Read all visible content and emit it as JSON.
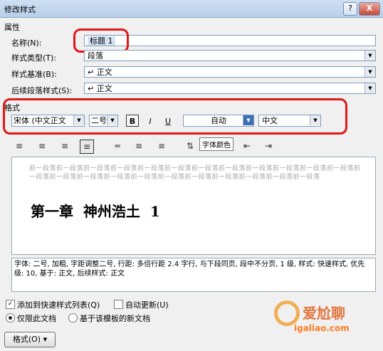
{
  "window": {
    "title": "修改样式",
    "help": "?",
    "close": "X"
  },
  "properties": {
    "section": "属性",
    "name_label": "名称(N):",
    "name_value": "标题 1",
    "type_label": "样式类型(T):",
    "type_value": "段落",
    "based_label": "样式基准(B):",
    "based_value": "↵ 正文",
    "next_label": "后续段落样式(S):",
    "next_value": "↵ 正文"
  },
  "format": {
    "section": "格式",
    "font": "宋体 (中文正文",
    "size": "二号",
    "bold": "B",
    "italic": "I",
    "underline": "U",
    "color": "自动",
    "lang": "中文",
    "tooltip": "字体颜色"
  },
  "preview": {
    "prev_text": "前一段落前一段落前一段落前一段落前一段落前一段落前一段落前一段落前一段落前一段落前一段落前一段落前一段落前一段落前一段落前一段落前一段落前一段落前一段落前一段落前一段落前一段落前一段落",
    "heading": "第一章  神州浩土  1"
  },
  "description": "字体: 二号, 加粗, 字距调整二号, 行距: 多倍行距 2.4 字行, 与下段同页, 段中不分页, 1 级, 样式: 快速样式, 优先级: 10, 基于: 正文, 后续样式: 正文",
  "options": {
    "add_quick": "添加到快速样式列表(Q)",
    "add_quick_checked": true,
    "auto_update": "自动更新(U)",
    "auto_update_checked": false,
    "only_doc": "仅限此文档",
    "only_doc_selected": true,
    "new_docs": "基于该模板的新文档",
    "new_docs_selected": false
  },
  "bottom": {
    "format_button": "格式(O) ▾"
  },
  "watermark": {
    "line1": "爱尬聊",
    "line2": "igaliao.com"
  }
}
